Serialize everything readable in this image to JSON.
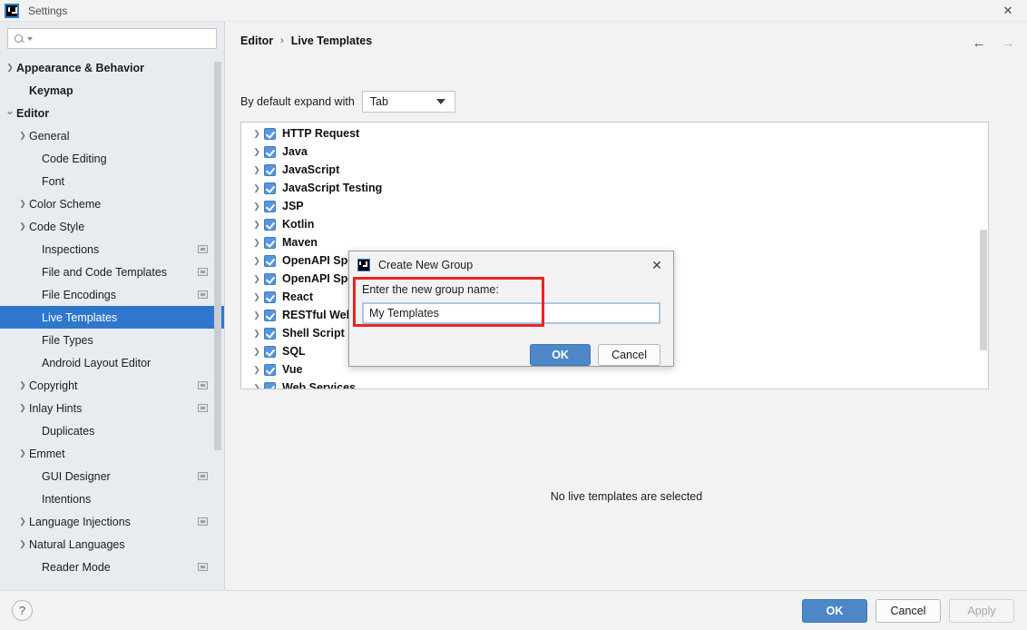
{
  "window": {
    "title": "Settings",
    "logo_icon": "intellij-idea-logo",
    "close_icon": "close-icon"
  },
  "sidebar": {
    "search": {
      "placeholder": "",
      "value": "",
      "icon": "search-icon",
      "caret_icon": "chevron-down-icon"
    },
    "items": [
      {
        "label": "Appearance & Behavior",
        "arrow": "chevron-right-icon",
        "bold": true,
        "indent": 0,
        "badge": false,
        "selected": false
      },
      {
        "label": "Keymap",
        "arrow": "",
        "bold": true,
        "indent": 1,
        "badge": false,
        "selected": false
      },
      {
        "label": "Editor",
        "arrow": "chevron-down-icon",
        "bold": true,
        "indent": 0,
        "badge": false,
        "selected": false
      },
      {
        "label": "General",
        "arrow": "chevron-right-icon",
        "bold": false,
        "indent": 1,
        "badge": false,
        "selected": false
      },
      {
        "label": "Code Editing",
        "arrow": "",
        "bold": false,
        "indent": 2,
        "badge": false,
        "selected": false
      },
      {
        "label": "Font",
        "arrow": "",
        "bold": false,
        "indent": 2,
        "badge": false,
        "selected": false
      },
      {
        "label": "Color Scheme",
        "arrow": "chevron-right-icon",
        "bold": false,
        "indent": 1,
        "badge": false,
        "selected": false
      },
      {
        "label": "Code Style",
        "arrow": "chevron-right-icon",
        "bold": false,
        "indent": 1,
        "badge": false,
        "selected": false
      },
      {
        "label": "Inspections",
        "arrow": "",
        "bold": false,
        "indent": 2,
        "badge": true,
        "selected": false
      },
      {
        "label": "File and Code Templates",
        "arrow": "",
        "bold": false,
        "indent": 2,
        "badge": true,
        "selected": false
      },
      {
        "label": "File Encodings",
        "arrow": "",
        "bold": false,
        "indent": 2,
        "badge": true,
        "selected": false
      },
      {
        "label": "Live Templates",
        "arrow": "",
        "bold": false,
        "indent": 2,
        "badge": false,
        "selected": true
      },
      {
        "label": "File Types",
        "arrow": "",
        "bold": false,
        "indent": 2,
        "badge": false,
        "selected": false
      },
      {
        "label": "Android Layout Editor",
        "arrow": "",
        "bold": false,
        "indent": 2,
        "badge": false,
        "selected": false
      },
      {
        "label": "Copyright",
        "arrow": "chevron-right-icon",
        "bold": false,
        "indent": 1,
        "badge": true,
        "selected": false
      },
      {
        "label": "Inlay Hints",
        "arrow": "chevron-right-icon",
        "bold": false,
        "indent": 1,
        "badge": true,
        "selected": false
      },
      {
        "label": "Duplicates",
        "arrow": "",
        "bold": false,
        "indent": 2,
        "badge": false,
        "selected": false
      },
      {
        "label": "Emmet",
        "arrow": "chevron-right-icon",
        "bold": false,
        "indent": 1,
        "badge": false,
        "selected": false
      },
      {
        "label": "GUI Designer",
        "arrow": "",
        "bold": false,
        "indent": 2,
        "badge": true,
        "selected": false
      },
      {
        "label": "Intentions",
        "arrow": "",
        "bold": false,
        "indent": 2,
        "badge": false,
        "selected": false
      },
      {
        "label": "Language Injections",
        "arrow": "chevron-right-icon",
        "bold": false,
        "indent": 1,
        "badge": true,
        "selected": false
      },
      {
        "label": "Natural Languages",
        "arrow": "chevron-right-icon",
        "bold": false,
        "indent": 1,
        "badge": false,
        "selected": false
      },
      {
        "label": "Reader Mode",
        "arrow": "",
        "bold": false,
        "indent": 2,
        "badge": true,
        "selected": false
      }
    ]
  },
  "main": {
    "breadcrumb": {
      "root": "Editor",
      "separator": "›",
      "leaf": "Live Templates"
    },
    "nav": {
      "back_icon": "arrow-left-icon",
      "forward_icon": "arrow-right-icon"
    },
    "expand_with": {
      "label": "By default expand with",
      "value": "Tab",
      "arrow_icon": "chevron-down-icon"
    },
    "templates": [
      {
        "label": "HTTP Request",
        "checked": true
      },
      {
        "label": "Java",
        "checked": true
      },
      {
        "label": "JavaScript",
        "checked": true
      },
      {
        "label": "JavaScript Testing",
        "checked": true
      },
      {
        "label": "JSP",
        "checked": true
      },
      {
        "label": "Kotlin",
        "checked": true
      },
      {
        "label": "Maven",
        "checked": true
      },
      {
        "label": "OpenAPI Specifications (.json)",
        "checked": true
      },
      {
        "label": "OpenAPI Specifications (.yaml)",
        "checked": true
      },
      {
        "label": "React",
        "checked": true
      },
      {
        "label": "RESTful Web Services",
        "checked": true
      },
      {
        "label": "Shell Script",
        "checked": true
      },
      {
        "label": "SQL",
        "checked": true
      },
      {
        "label": "Vue",
        "checked": true
      },
      {
        "label": "Web Services",
        "checked": true
      }
    ],
    "toolbar": [
      {
        "name": "add-button",
        "icon": "plus-icon"
      },
      {
        "name": "remove-button",
        "icon": "minus-icon"
      },
      {
        "name": "duplicate-button",
        "icon": "copy-icon"
      },
      {
        "name": "revert-button",
        "icon": "revert-icon"
      }
    ],
    "empty_message": "No live templates are selected"
  },
  "dialog": {
    "title": "Create New Group",
    "logo_icon": "intellij-idea-logo",
    "close_icon": "close-icon",
    "prompt": "Enter the new group name:",
    "input_value": "My Templates",
    "input_placeholder": "",
    "ok_label": "OK",
    "cancel_label": "Cancel"
  },
  "footer": {
    "help_label": "?",
    "ok_label": "OK",
    "cancel_label": "Cancel",
    "apply_label": "Apply"
  },
  "colors": {
    "accent": "#2f77cc",
    "button_primary": "#4d87c7",
    "checkbox": "#5596dd",
    "highlight_outline": "#ee2222",
    "sidebar_bg": "#e8ecf0",
    "panel_bg": "#f2f2f2"
  }
}
